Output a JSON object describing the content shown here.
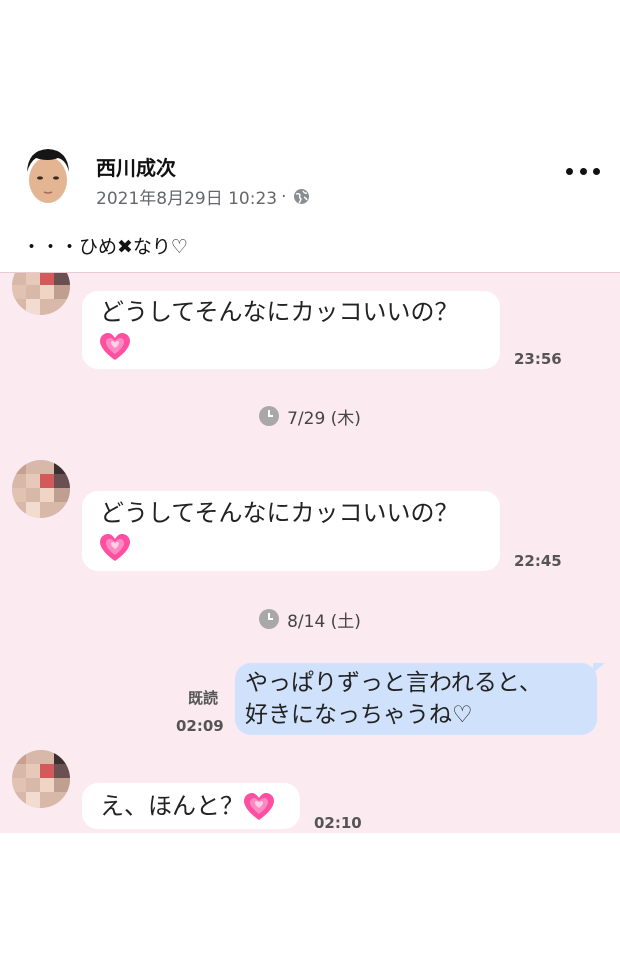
{
  "post": {
    "author": "西川成次",
    "date": "2021年8月29日 10:23",
    "separator": "·",
    "privacy_icon": "globe-icon",
    "more_icon": "more-options-icon",
    "caption": "・・・ひめ✖なり♡"
  },
  "chat": {
    "background": "#fbeaf0",
    "messages": [
      {
        "text_line1": "どうしてそんなにカッコいいの？",
        "emoji": "growing-heart-icon",
        "time": "23:56"
      },
      {
        "text_line1": "どうしてそんなにカッコいいの？",
        "emoji": "growing-heart-icon",
        "time": "22:45"
      },
      {
        "line1": "やっぱりずっと言われると、",
        "line2": "好きになっちゃうね♡",
        "read": "既読",
        "time": "02:09"
      },
      {
        "text_line1": "え、ほんと？",
        "emoji": "growing-heart-icon",
        "time": "02:10"
      }
    ],
    "dividers": [
      {
        "label": "7/29 (木)"
      },
      {
        "label": "8/14 (土)"
      }
    ]
  }
}
